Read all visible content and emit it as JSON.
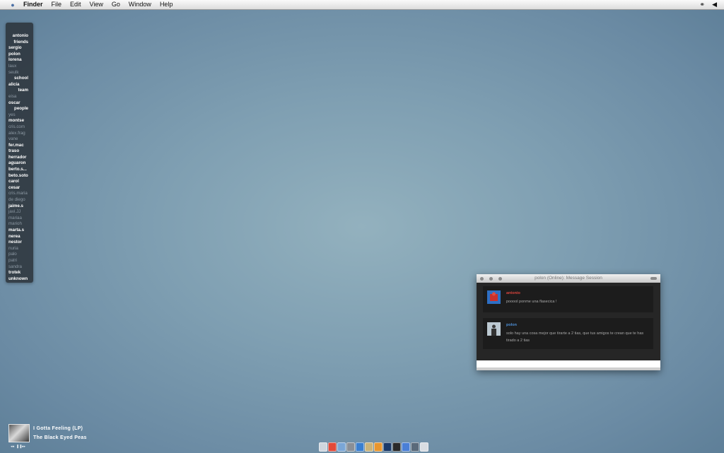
{
  "menubar": {
    "apple_icon": "apple-icon",
    "app_name": "Finder",
    "menus": [
      "File",
      "Edit",
      "View",
      "Go",
      "Window",
      "Help"
    ],
    "status_icons": [
      "headphones-icon",
      "volume-icon"
    ]
  },
  "buddy_list": {
    "entries": [
      {
        "label": "antonio",
        "type": "group"
      },
      {
        "label": "friends",
        "type": "group"
      },
      {
        "label": "sergio",
        "type": "online"
      },
      {
        "label": "polon",
        "type": "online"
      },
      {
        "label": "lorena",
        "type": "online"
      },
      {
        "label": "laux",
        "type": "offline"
      },
      {
        "label": "seulk",
        "type": "offline"
      },
      {
        "label": "school",
        "type": "group"
      },
      {
        "label": "alicia",
        "type": "online"
      },
      {
        "label": "team",
        "type": "group"
      },
      {
        "label": "eisa",
        "type": "offline"
      },
      {
        "label": "oscar",
        "type": "online"
      },
      {
        "label": "people",
        "type": "group"
      },
      {
        "label": "yes",
        "type": "offline"
      },
      {
        "label": "montse",
        "type": "online"
      },
      {
        "label": "cris.com",
        "type": "offline"
      },
      {
        "label": "alex.frag",
        "type": "offline"
      },
      {
        "label": "vane",
        "type": "offline"
      },
      {
        "label": "fer.mac",
        "type": "online"
      },
      {
        "label": "traso",
        "type": "online"
      },
      {
        "label": "herrador",
        "type": "online"
      },
      {
        "label": "aguaron",
        "type": "online"
      },
      {
        "label": "berto.s...",
        "type": "online"
      },
      {
        "label": "beto.soto",
        "type": "online"
      },
      {
        "label": "carol",
        "type": "online"
      },
      {
        "label": "cesar",
        "type": "online"
      },
      {
        "label": "cris.maria",
        "type": "offline"
      },
      {
        "label": "de diego",
        "type": "offline"
      },
      {
        "label": "jaime.s",
        "type": "online"
      },
      {
        "label": "javi.JJ",
        "type": "offline"
      },
      {
        "label": "mariaa",
        "type": "offline"
      },
      {
        "label": "marioh",
        "type": "offline"
      },
      {
        "label": "marta.s",
        "type": "online"
      },
      {
        "label": "nerea",
        "type": "online"
      },
      {
        "label": "nestor",
        "type": "online"
      },
      {
        "label": "nuria",
        "type": "offline"
      },
      {
        "label": "palo",
        "type": "offline"
      },
      {
        "label": "patri",
        "type": "offline"
      },
      {
        "label": "sandra",
        "type": "offline"
      },
      {
        "label": "trotek",
        "type": "online"
      },
      {
        "label": "unknown",
        "type": "online"
      }
    ]
  },
  "message_window": {
    "title": "polon (Online): Message Session",
    "messages": [
      {
        "sender": "antonio",
        "text": "pooool ponme una flasecica !",
        "sender_color": "#d9443c",
        "avatar": "avatar-antonio"
      },
      {
        "sender": "polon",
        "text": "solo hay una cosa mejor que tirarte a 2 tias, que tus amigos te crean que te has tirado a 2 tias",
        "sender_color": "#4d8fd6",
        "avatar": "avatar-polon"
      }
    ],
    "input_value": ""
  },
  "now_playing": {
    "title": "I Gotta Feeling (LP)",
    "artist": "The Black Eyed Peas",
    "controls": [
      "◂◂",
      "❚❚",
      "▸▸"
    ]
  },
  "dock": {
    "apps": [
      {
        "name": "finder-icon",
        "color": "#cfd6de"
      },
      {
        "name": "ical-icon",
        "color": "#e24a3a"
      },
      {
        "name": "mail-icon",
        "color": "#7aa6d6"
      },
      {
        "name": "system-preferences-icon",
        "color": "#8a8f96"
      },
      {
        "name": "safari-icon",
        "color": "#3a7fd0"
      },
      {
        "name": "preview-icon",
        "color": "#c9b37a"
      },
      {
        "name": "adium-icon",
        "color": "#e8962e"
      },
      {
        "name": "photoshop-icon",
        "color": "#1a3a6a"
      },
      {
        "name": "terminal-icon",
        "color": "#2a2a2a"
      },
      {
        "name": "itunes-icon",
        "color": "#4a7fd6"
      },
      {
        "name": "activity-icon",
        "color": "#5a6a7a"
      },
      {
        "name": "trash-icon",
        "color": "#d9dde2"
      }
    ]
  }
}
